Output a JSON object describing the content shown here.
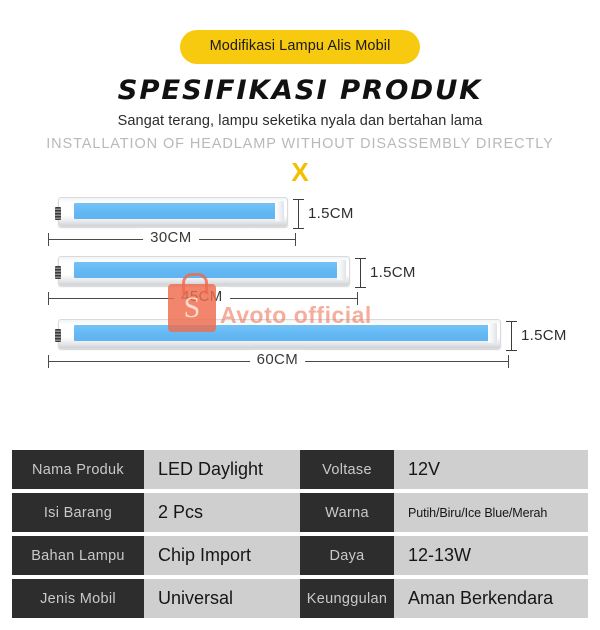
{
  "badge": {
    "label": "Modifikasi Lampu Alis Mobil"
  },
  "header": {
    "title": "SPESIFIKASI PRODUK",
    "subtitle_id": "Sangat terang, lampu seketika nyala dan bertahan lama",
    "subtitle_en": "INSTALLATION OF HEADLAMP WITHOUT DISASSEMBLY DIRECTLY",
    "x_mark": "X"
  },
  "products": [
    {
      "length_label": "30CM",
      "height_label": "1.5CM"
    },
    {
      "length_label": "45CM",
      "height_label": "1.5CM"
    },
    {
      "length_label": "60CM",
      "height_label": "1.5CM"
    }
  ],
  "watermark": {
    "logo_letter": "S",
    "text": "Avoto official"
  },
  "spec_table": {
    "rows": [
      {
        "key_left": "Nama Produk",
        "value_left": "LED Daylight",
        "key_right": "Voltase",
        "value_right": "12V"
      },
      {
        "key_left": "Isi Barang",
        "value_left": "2 Pcs",
        "key_right": "Warna",
        "value_right": "Putih/Biru/Ice Blue/Merah"
      },
      {
        "key_left": "Bahan Lampu",
        "value_left": "Chip Import",
        "key_right": "Daya",
        "value_right": "12-13W"
      },
      {
        "key_left": "Jenis Mobil",
        "value_left": "Universal",
        "key_right": "Keunggulan",
        "value_right": "Aman Berkendara"
      }
    ]
  },
  "colors": {
    "badge_yellow": "#F7C90F",
    "led_blue": "#63B8F3",
    "table_key_bg": "#2d2d2d",
    "table_value_bg": "#cfcfcf",
    "watermark_orange": "#EE6B4D"
  }
}
